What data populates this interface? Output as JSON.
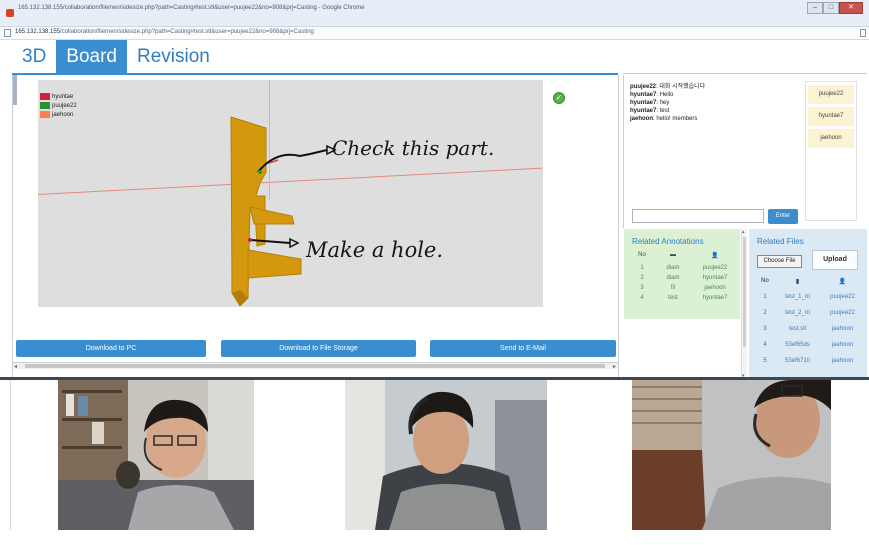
{
  "window": {
    "title": "165.132.138.155/collaboration/filemen/sidesize.php?path=Casting#test.stl&user=puujee22&no=908&prj=Casting - Google Chrome",
    "url_host": "165.132.138.155",
    "url_path": "/collaboration/filemen/sidesize.php?path=Casting#test.stl&user=puujee22&no=908&prj=Casting",
    "buttons": [
      "minimize",
      "maximize",
      "close"
    ]
  },
  "nav": {
    "tabs": [
      {
        "label": "3D",
        "active": false
      },
      {
        "label": "Board",
        "active": true
      },
      {
        "label": "Revision",
        "active": false
      }
    ]
  },
  "viewer": {
    "legend": [
      {
        "name": "hyuntae",
        "color": "#d21f3c"
      },
      {
        "name": "puujee22",
        "color": "#2f8f2f"
      },
      {
        "name": "jaehoon",
        "color": "#ff7f50"
      }
    ],
    "annotations": [
      "Check this part.",
      "Make a hole."
    ],
    "part_color": "#d4980f",
    "status_icon": "check-circle-icon"
  },
  "actions": {
    "download_pc": "Download to PC",
    "download_storage": "Download to File Storage",
    "send_email": "Send to E-Mail"
  },
  "chat": {
    "messages": [
      {
        "user": "puujee22",
        "text": "대화 시작했습니다"
      },
      {
        "user": "hyuntae7",
        "text": "Hello"
      },
      {
        "user": "hyuntae7",
        "text": "hey"
      },
      {
        "user": "hyuntae7",
        "text": "test"
      },
      {
        "user": "jaehoon",
        "text": "hello! members"
      }
    ],
    "users": [
      "puujee22",
      "hyuntae7",
      "jaehoon"
    ],
    "input_value": "",
    "enter_label": "Enter"
  },
  "related_annotations": {
    "title": "Related Annotations",
    "header": {
      "no": "No",
      "title_icon": "comment-icon",
      "user_icon": "user-icon"
    },
    "rows": [
      {
        "no": "1",
        "title": "diam",
        "user": "puujee22"
      },
      {
        "no": "2",
        "title": "diam",
        "user": "hyuntae7"
      },
      {
        "no": "3",
        "title": "fil",
        "user": "jaehoon"
      },
      {
        "no": "4",
        "title": "test",
        "user": "hyuntae7"
      }
    ]
  },
  "related_files": {
    "title": "Related Files",
    "choose_label": "Choose File",
    "upload_label": "Upload",
    "header": {
      "no": "No",
      "file_icon": "file-icon",
      "user_icon": "user-icon"
    },
    "rows": [
      {
        "no": "1",
        "name": "test_1_m",
        "user": "puujee22"
      },
      {
        "no": "2",
        "name": "test_2_m",
        "user": "puujee22"
      },
      {
        "no": "3",
        "name": "test.stl",
        "user": "jaehoon"
      },
      {
        "no": "4",
        "name": "53ef65ds",
        "user": "jaehoon"
      },
      {
        "no": "5",
        "name": "53ef6710",
        "user": "jaehoon"
      }
    ]
  },
  "video_feeds": [
    "video-feed-1",
    "video-feed-2",
    "video-feed-3"
  ]
}
